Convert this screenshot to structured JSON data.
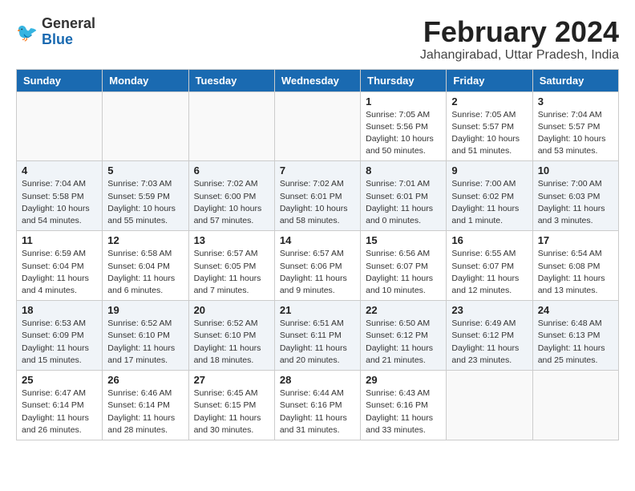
{
  "logo": {
    "general": "General",
    "blue": "Blue"
  },
  "header": {
    "month_year": "February 2024",
    "location": "Jahangirabad, Uttar Pradesh, India"
  },
  "weekdays": [
    "Sunday",
    "Monday",
    "Tuesday",
    "Wednesday",
    "Thursday",
    "Friday",
    "Saturday"
  ],
  "weeks": [
    [
      {
        "day": "",
        "sunrise": "",
        "sunset": "",
        "daylight": ""
      },
      {
        "day": "",
        "sunrise": "",
        "sunset": "",
        "daylight": ""
      },
      {
        "day": "",
        "sunrise": "",
        "sunset": "",
        "daylight": ""
      },
      {
        "day": "",
        "sunrise": "",
        "sunset": "",
        "daylight": ""
      },
      {
        "day": "1",
        "sunrise": "Sunrise: 7:05 AM",
        "sunset": "Sunset: 5:56 PM",
        "daylight": "Daylight: 10 hours and 50 minutes."
      },
      {
        "day": "2",
        "sunrise": "Sunrise: 7:05 AM",
        "sunset": "Sunset: 5:57 PM",
        "daylight": "Daylight: 10 hours and 51 minutes."
      },
      {
        "day": "3",
        "sunrise": "Sunrise: 7:04 AM",
        "sunset": "Sunset: 5:57 PM",
        "daylight": "Daylight: 10 hours and 53 minutes."
      }
    ],
    [
      {
        "day": "4",
        "sunrise": "Sunrise: 7:04 AM",
        "sunset": "Sunset: 5:58 PM",
        "daylight": "Daylight: 10 hours and 54 minutes."
      },
      {
        "day": "5",
        "sunrise": "Sunrise: 7:03 AM",
        "sunset": "Sunset: 5:59 PM",
        "daylight": "Daylight: 10 hours and 55 minutes."
      },
      {
        "day": "6",
        "sunrise": "Sunrise: 7:02 AM",
        "sunset": "Sunset: 6:00 PM",
        "daylight": "Daylight: 10 hours and 57 minutes."
      },
      {
        "day": "7",
        "sunrise": "Sunrise: 7:02 AM",
        "sunset": "Sunset: 6:01 PM",
        "daylight": "Daylight: 10 hours and 58 minutes."
      },
      {
        "day": "8",
        "sunrise": "Sunrise: 7:01 AM",
        "sunset": "Sunset: 6:01 PM",
        "daylight": "Daylight: 11 hours and 0 minutes."
      },
      {
        "day": "9",
        "sunrise": "Sunrise: 7:00 AM",
        "sunset": "Sunset: 6:02 PM",
        "daylight": "Daylight: 11 hours and 1 minute."
      },
      {
        "day": "10",
        "sunrise": "Sunrise: 7:00 AM",
        "sunset": "Sunset: 6:03 PM",
        "daylight": "Daylight: 11 hours and 3 minutes."
      }
    ],
    [
      {
        "day": "11",
        "sunrise": "Sunrise: 6:59 AM",
        "sunset": "Sunset: 6:04 PM",
        "daylight": "Daylight: 11 hours and 4 minutes."
      },
      {
        "day": "12",
        "sunrise": "Sunrise: 6:58 AM",
        "sunset": "Sunset: 6:04 PM",
        "daylight": "Daylight: 11 hours and 6 minutes."
      },
      {
        "day": "13",
        "sunrise": "Sunrise: 6:57 AM",
        "sunset": "Sunset: 6:05 PM",
        "daylight": "Daylight: 11 hours and 7 minutes."
      },
      {
        "day": "14",
        "sunrise": "Sunrise: 6:57 AM",
        "sunset": "Sunset: 6:06 PM",
        "daylight": "Daylight: 11 hours and 9 minutes."
      },
      {
        "day": "15",
        "sunrise": "Sunrise: 6:56 AM",
        "sunset": "Sunset: 6:07 PM",
        "daylight": "Daylight: 11 hours and 10 minutes."
      },
      {
        "day": "16",
        "sunrise": "Sunrise: 6:55 AM",
        "sunset": "Sunset: 6:07 PM",
        "daylight": "Daylight: 11 hours and 12 minutes."
      },
      {
        "day": "17",
        "sunrise": "Sunrise: 6:54 AM",
        "sunset": "Sunset: 6:08 PM",
        "daylight": "Daylight: 11 hours and 13 minutes."
      }
    ],
    [
      {
        "day": "18",
        "sunrise": "Sunrise: 6:53 AM",
        "sunset": "Sunset: 6:09 PM",
        "daylight": "Daylight: 11 hours and 15 minutes."
      },
      {
        "day": "19",
        "sunrise": "Sunrise: 6:52 AM",
        "sunset": "Sunset: 6:10 PM",
        "daylight": "Daylight: 11 hours and 17 minutes."
      },
      {
        "day": "20",
        "sunrise": "Sunrise: 6:52 AM",
        "sunset": "Sunset: 6:10 PM",
        "daylight": "Daylight: 11 hours and 18 minutes."
      },
      {
        "day": "21",
        "sunrise": "Sunrise: 6:51 AM",
        "sunset": "Sunset: 6:11 PM",
        "daylight": "Daylight: 11 hours and 20 minutes."
      },
      {
        "day": "22",
        "sunrise": "Sunrise: 6:50 AM",
        "sunset": "Sunset: 6:12 PM",
        "daylight": "Daylight: 11 hours and 21 minutes."
      },
      {
        "day": "23",
        "sunrise": "Sunrise: 6:49 AM",
        "sunset": "Sunset: 6:12 PM",
        "daylight": "Daylight: 11 hours and 23 minutes."
      },
      {
        "day": "24",
        "sunrise": "Sunrise: 6:48 AM",
        "sunset": "Sunset: 6:13 PM",
        "daylight": "Daylight: 11 hours and 25 minutes."
      }
    ],
    [
      {
        "day": "25",
        "sunrise": "Sunrise: 6:47 AM",
        "sunset": "Sunset: 6:14 PM",
        "daylight": "Daylight: 11 hours and 26 minutes."
      },
      {
        "day": "26",
        "sunrise": "Sunrise: 6:46 AM",
        "sunset": "Sunset: 6:14 PM",
        "daylight": "Daylight: 11 hours and 28 minutes."
      },
      {
        "day": "27",
        "sunrise": "Sunrise: 6:45 AM",
        "sunset": "Sunset: 6:15 PM",
        "daylight": "Daylight: 11 hours and 30 minutes."
      },
      {
        "day": "28",
        "sunrise": "Sunrise: 6:44 AM",
        "sunset": "Sunset: 6:16 PM",
        "daylight": "Daylight: 11 hours and 31 minutes."
      },
      {
        "day": "29",
        "sunrise": "Sunrise: 6:43 AM",
        "sunset": "Sunset: 6:16 PM",
        "daylight": "Daylight: 11 hours and 33 minutes."
      },
      {
        "day": "",
        "sunrise": "",
        "sunset": "",
        "daylight": ""
      },
      {
        "day": "",
        "sunrise": "",
        "sunset": "",
        "daylight": ""
      }
    ]
  ]
}
